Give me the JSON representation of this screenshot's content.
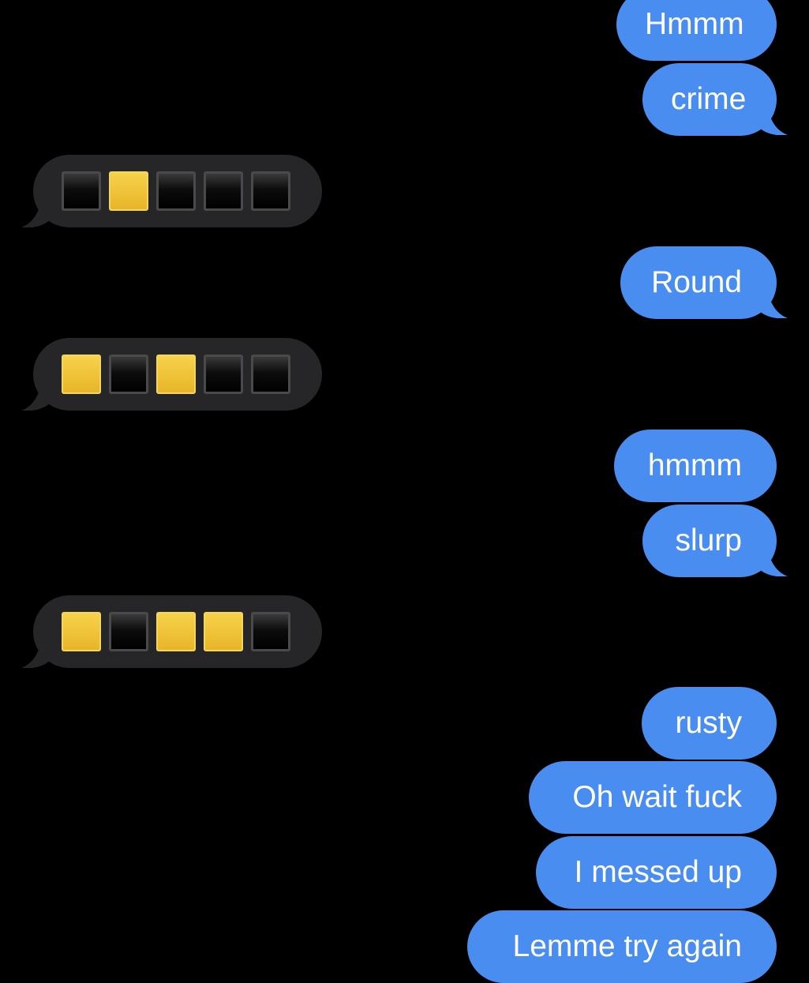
{
  "messages": [
    {
      "type": "sent",
      "text": "Hmmm"
    },
    {
      "type": "sent",
      "text": "crime"
    },
    {
      "type": "received",
      "pattern": [
        "black",
        "yellow",
        "black",
        "black",
        "black"
      ]
    },
    {
      "type": "sent",
      "text": "Round"
    },
    {
      "type": "received",
      "pattern": [
        "yellow",
        "black",
        "yellow",
        "black",
        "black"
      ]
    },
    {
      "type": "sent",
      "text": "hmmm"
    },
    {
      "type": "sent",
      "text": "slurp"
    },
    {
      "type": "received",
      "pattern": [
        "yellow",
        "black",
        "yellow",
        "yellow",
        "black"
      ]
    },
    {
      "type": "sent",
      "text": "rusty"
    },
    {
      "type": "sent",
      "text": "Oh wait fuck"
    },
    {
      "type": "sent",
      "text": "I messed up"
    },
    {
      "type": "sent",
      "text": "Lemme try again"
    }
  ],
  "colors": {
    "background": "#000000",
    "sent_bubble": "#4a8df0",
    "received_bubble": "#262628",
    "square_yellow": "#e8b528",
    "square_black": "#000000"
  }
}
